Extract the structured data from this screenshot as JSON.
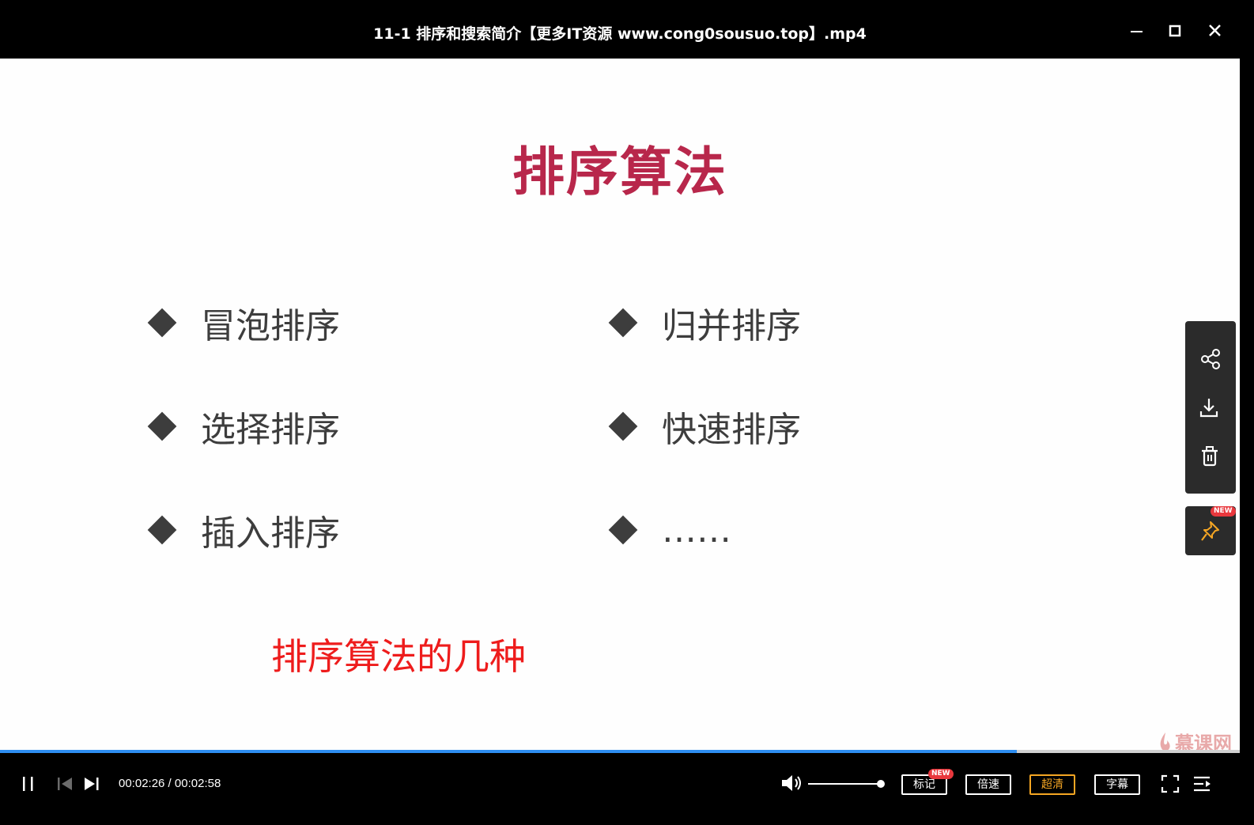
{
  "window": {
    "title": "11-1 排序和搜索简介【更多IT资源 www.cong0sousuo.top】.mp4"
  },
  "slide": {
    "title": "排序算法",
    "left_items": [
      "冒泡排序",
      "选择排序",
      "插入排序"
    ],
    "right_items": [
      "归并排序",
      "快速排序",
      "……"
    ],
    "subtitle": "排序算法的几种",
    "watermark": "慕课网"
  },
  "side_panel": {
    "pin_badge": "NEW"
  },
  "player": {
    "progress": 0.82,
    "current_time": "00:02:26",
    "total_time": "00:02:58",
    "time_separator": " / ",
    "volume": 1.0,
    "buttons": {
      "mark": "标记",
      "mark_badge": "NEW",
      "speed": "倍速",
      "quality": "超清",
      "subtitle": "字幕"
    },
    "colors": {
      "progress": "#2e8ef0",
      "quality_active": "#f5a623",
      "title_red": "#b8274b",
      "subtitle_red": "#ee1c1c"
    }
  }
}
